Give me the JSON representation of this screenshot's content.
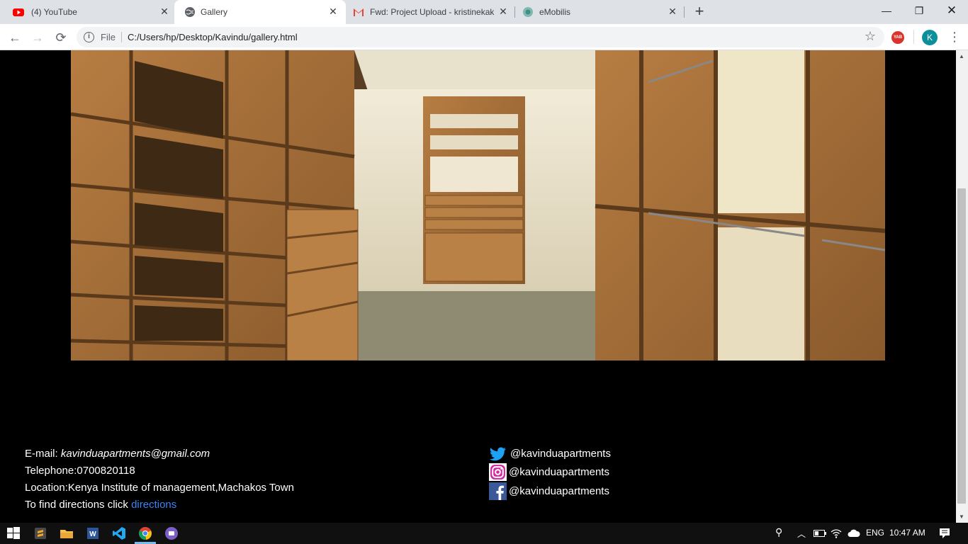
{
  "tabs": [
    {
      "title": "(4) YouTube",
      "icon": "youtube-icon"
    },
    {
      "title": "Gallery",
      "icon": "globe-icon"
    },
    {
      "title": "Fwd: Project Upload - kristinekak",
      "icon": "gmail-icon"
    },
    {
      "title": "eMobilis",
      "icon": "emobilis-icon"
    }
  ],
  "toolbar": {
    "scheme": "File",
    "url": "C:/Users/hp/Desktop/Kavindu/gallery.html",
    "extension_label": "YAB",
    "profile_initial": "K"
  },
  "footer": {
    "email_label": "E-mail: ",
    "email_value": "kavinduapartments@gmail.com",
    "telephone": "Telephone:0700820118",
    "location": "Location:Kenya Institute of management,Machakos Town",
    "directions_prefix": "To find directions click ",
    "directions_link": "directions",
    "social": [
      {
        "network": "twitter",
        "handle": "@kavinduapartments",
        "icon": "twitter-icon"
      },
      {
        "network": "instagram",
        "handle": "@kavinduapartments",
        "icon": "instagram-icon"
      },
      {
        "network": "facebook",
        "handle": "@kavinduapartments",
        "icon": "facebook-icon"
      }
    ]
  },
  "taskbar": {
    "language": "ENG",
    "time": "10:47 AM"
  },
  "colors": {
    "link": "#3b82f6",
    "page_background": "#000000",
    "wood": "#a8743d"
  }
}
